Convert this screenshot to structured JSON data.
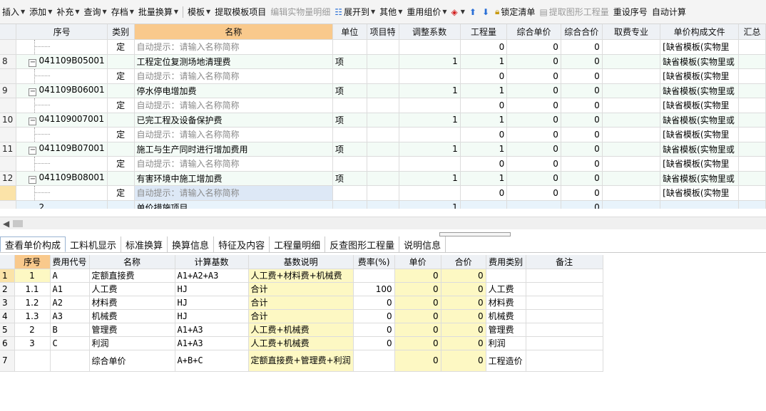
{
  "toolbar": {
    "items": [
      {
        "label": "插入",
        "caret": true
      },
      {
        "label": "添加",
        "caret": true
      },
      {
        "label": "补充",
        "caret": true
      },
      {
        "label": "查询",
        "caret": true
      },
      {
        "label": "存档",
        "caret": true
      },
      {
        "label": "批量换算",
        "caret": true
      },
      {
        "label": "模板",
        "caret": true
      },
      {
        "label": "提取模板项目"
      },
      {
        "label": "编辑实物量明细",
        "disabled": true
      },
      {
        "label": "展开到",
        "caret": true
      },
      {
        "label": "其他",
        "caret": true
      },
      {
        "label": "重用组价",
        "caret": true
      },
      {
        "label": "锁定清单"
      },
      {
        "label": "提取图形工程量",
        "disabled": true
      },
      {
        "label": "重设序号"
      },
      {
        "label": "自动计算"
      }
    ]
  },
  "upper_grid": {
    "columns": [
      "",
      "序号",
      "类别",
      "名称",
      "单位",
      "项目特",
      "调整系数",
      "工程量",
      "综合单价",
      "综合合价",
      "取费专业",
      "单价构成文件",
      "汇总"
    ],
    "rows": [
      {
        "no": "",
        "code": "",
        "type": "定",
        "name": "自动提示：请输入名称简称",
        "unit": "",
        "feature": "",
        "coef": "",
        "qty": "0",
        "price": "0",
        "total": "0",
        "fee": "",
        "file": "[缺省模板(实物里",
        "hint": true,
        "child": true
      },
      {
        "no": "8",
        "code": "041109B05001",
        "type": "",
        "name": "工程定位复测场地清理费",
        "unit": "项",
        "feature": "",
        "coef": "1",
        "qty": "1",
        "price": "0",
        "total": "0",
        "fee": "",
        "file": "缺省模板(实物里或",
        "hint": false,
        "child": false
      },
      {
        "no": "",
        "code": "",
        "type": "定",
        "name": "自动提示：请输入名称简称",
        "unit": "",
        "feature": "",
        "coef": "",
        "qty": "0",
        "price": "0",
        "total": "0",
        "fee": "",
        "file": "[缺省模板(实物里",
        "hint": true,
        "child": true
      },
      {
        "no": "9",
        "code": "041109B06001",
        "type": "",
        "name": "停水停电增加费",
        "unit": "项",
        "feature": "",
        "coef": "1",
        "qty": "1",
        "price": "0",
        "total": "0",
        "fee": "",
        "file": "缺省模板(实物里或",
        "hint": false,
        "child": false
      },
      {
        "no": "",
        "code": "",
        "type": "定",
        "name": "自动提示：请输入名称简称",
        "unit": "",
        "feature": "",
        "coef": "",
        "qty": "0",
        "price": "0",
        "total": "0",
        "fee": "",
        "file": "[缺省模板(实物里",
        "hint": true,
        "child": true
      },
      {
        "no": "10",
        "code": "041109007001",
        "type": "",
        "name": "已完工程及设备保护费",
        "unit": "项",
        "feature": "",
        "coef": "1",
        "qty": "1",
        "price": "0",
        "total": "0",
        "fee": "",
        "file": "缺省模板(实物里或",
        "hint": false,
        "child": false
      },
      {
        "no": "",
        "code": "",
        "type": "定",
        "name": "自动提示：请输入名称简称",
        "unit": "",
        "feature": "",
        "coef": "",
        "qty": "0",
        "price": "0",
        "total": "0",
        "fee": "",
        "file": "[缺省模板(实物里",
        "hint": true,
        "child": true
      },
      {
        "no": "11",
        "code": "041109B07001",
        "type": "",
        "name": "施工与生产同时进行增加费用",
        "unit": "项",
        "feature": "",
        "coef": "1",
        "qty": "1",
        "price": "0",
        "total": "0",
        "fee": "",
        "file": "缺省模板(实物里或",
        "hint": false,
        "child": false
      },
      {
        "no": "",
        "code": "",
        "type": "定",
        "name": "自动提示：请输入名称简称",
        "unit": "",
        "feature": "",
        "coef": "",
        "qty": "0",
        "price": "0",
        "total": "0",
        "fee": "",
        "file": "[缺省模板(实物里",
        "hint": true,
        "child": true
      },
      {
        "no": "12",
        "code": "041109B08001",
        "type": "",
        "name": "有害环境中施工增加费",
        "unit": "项",
        "feature": "",
        "coef": "1",
        "qty": "1",
        "price": "0",
        "total": "0",
        "fee": "",
        "file": "缺省模板(实物里或",
        "hint": false,
        "child": false
      },
      {
        "no": "",
        "code": "",
        "type": "定",
        "name": "自动提示：请输入名称简称",
        "unit": "",
        "feature": "",
        "coef": "",
        "qty": "0",
        "price": "0",
        "total": "0",
        "fee": "",
        "file": "[缺省模板(实物里",
        "hint": true,
        "child": true,
        "selected": true
      }
    ],
    "total_row": {
      "no": "2",
      "name": "单价措施项目",
      "coef": "1",
      "total": "0"
    }
  },
  "tabs": [
    "查看单价构成",
    "工料机显示",
    "标准换算",
    "换算信息",
    "特征及内容",
    "工程量明细",
    "反查图形工程量",
    "说明信息"
  ],
  "active_tab": 0,
  "lower_grid": {
    "columns": [
      "",
      "序号",
      "费用代号",
      "名称",
      "计算基数",
      "基数说明",
      "费率(%)",
      "单价",
      "合价",
      "费用类别",
      "备注"
    ],
    "rows": [
      {
        "rn": "1",
        "no": "1",
        "code": "A",
        "name": "定额直接费",
        "base": "A1+A2+A3",
        "desc": "人工费+材料费+机械费",
        "rate": "",
        "price": "0",
        "total": "0",
        "cat": ""
      },
      {
        "rn": "2",
        "no": "1.1",
        "code": "A1",
        "name": "人工费",
        "base": "HJ",
        "desc": "合计",
        "rate": "100",
        "price": "0",
        "total": "0",
        "cat": "人工费"
      },
      {
        "rn": "3",
        "no": "1.2",
        "code": "A2",
        "name": "材料费",
        "base": "HJ",
        "desc": "合计",
        "rate": "0",
        "price": "0",
        "total": "0",
        "cat": "材料费"
      },
      {
        "rn": "4",
        "no": "1.3",
        "code": "A3",
        "name": "机械费",
        "base": "HJ",
        "desc": "合计",
        "rate": "0",
        "price": "0",
        "total": "0",
        "cat": "机械费"
      },
      {
        "rn": "5",
        "no": "2",
        "code": "B",
        "name": "管理费",
        "base": "A1+A3",
        "desc": "人工费+机械费",
        "rate": "0",
        "price": "0",
        "total": "0",
        "cat": "管理费"
      },
      {
        "rn": "6",
        "no": "3",
        "code": "C",
        "name": "利润",
        "base": "A1+A3",
        "desc": "人工费+机械费",
        "rate": "0",
        "price": "0",
        "total": "0",
        "cat": "利润"
      },
      {
        "rn": "7",
        "no": "",
        "code": "",
        "name": "综合单价",
        "base": "A+B+C",
        "desc": "定额直接费+管理费+利润",
        "rate": "",
        "price": "0",
        "total": "0",
        "cat": "工程造价"
      }
    ]
  }
}
